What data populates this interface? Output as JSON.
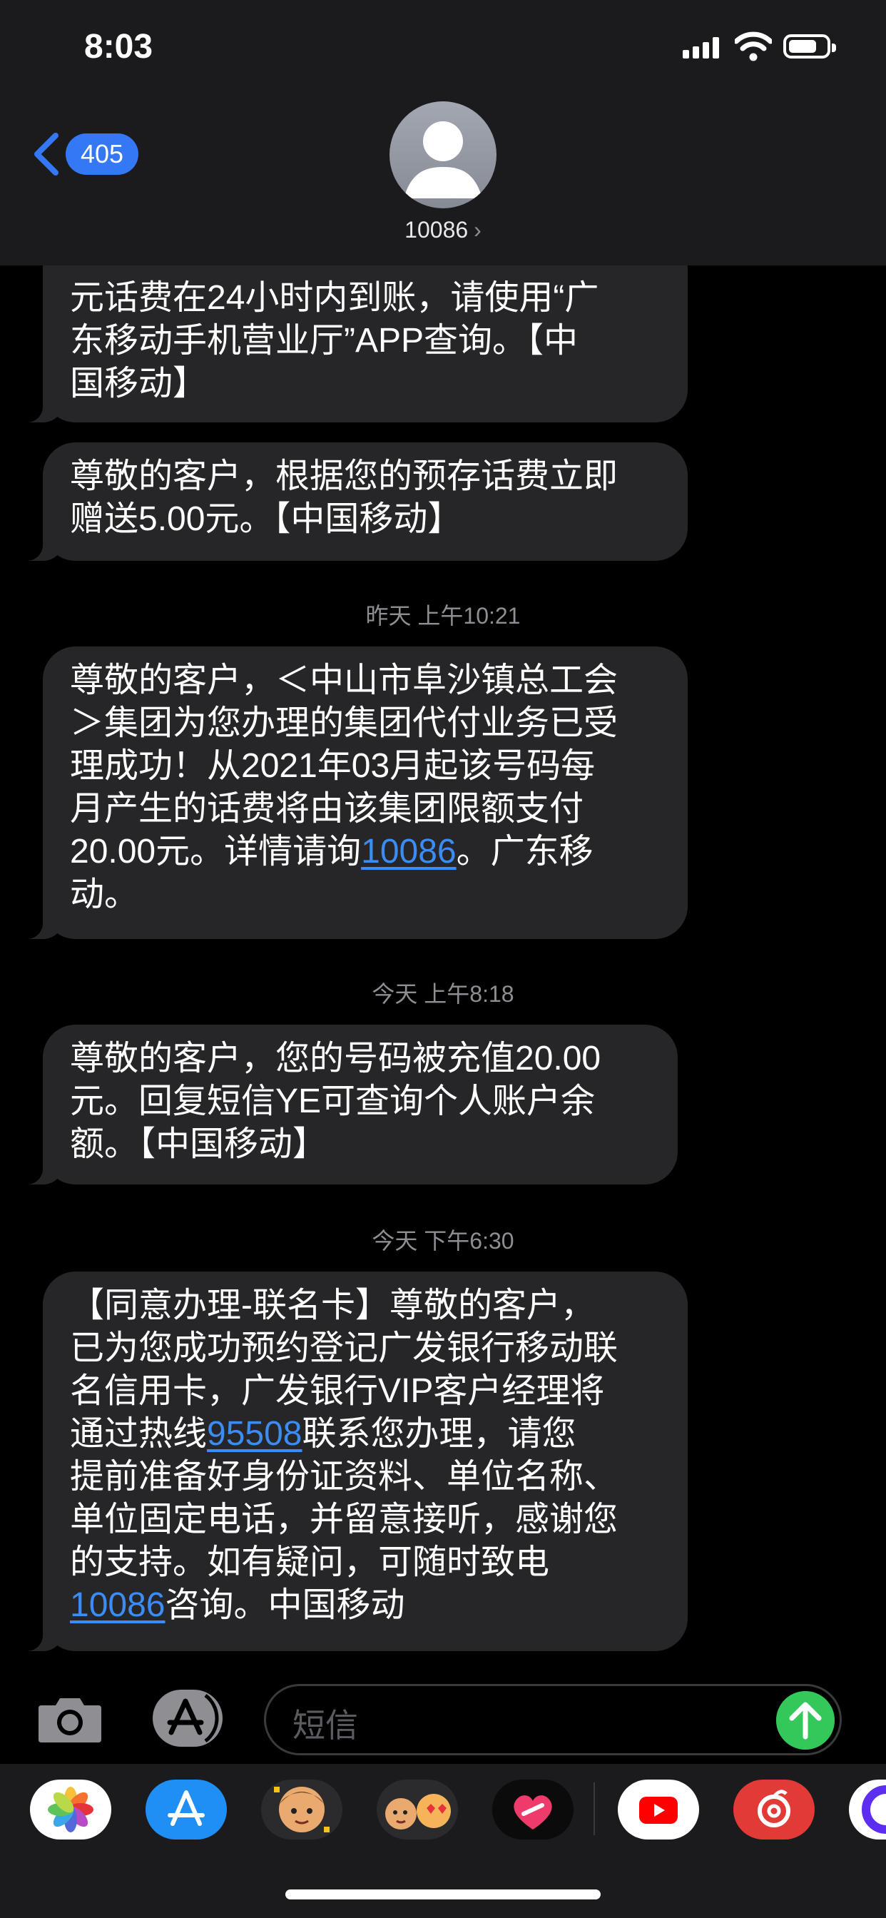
{
  "status_bar": {
    "time": "8:03",
    "battery_level": 0.75
  },
  "header": {
    "back_count": "405",
    "contact": "10086",
    "contact_chevron": "›"
  },
  "messages": [
    {
      "lines": [
        "元话费在24小时内到账，请使用“广",
        "东移动手机营业厅”APP查询。【中",
        "国移动】"
      ]
    },
    {
      "lines": [
        "尊敬的客户，根据您的预存话费立即",
        "赠送5.00元。【中国移动】"
      ]
    },
    {
      "timestamp": "昨天 上午10:21",
      "lines": [
        "尊敬的客户，＜中山市阜沙镇总工会",
        "＞集团为您办理的集团代付业务已受",
        "理成功！从2021年03月起该号码每",
        "月产生的话费将由该集团限额支付"
      ],
      "line5_pre": "20.00元。详情请询",
      "line5_link": "10086",
      "line5_post": "。广东移",
      "line6": "动。"
    },
    {
      "timestamp": "今天 上午8:18",
      "lines": [
        "尊敬的客户，您的号码被充值20.00",
        "元。回复短信YE可查询个人账户余",
        "额。【中国移动】"
      ]
    },
    {
      "timestamp": "今天 下午6:30",
      "lines": [
        "【同意办理-联名卡】尊敬的客户，",
        "已为您成功预约登记广发银行移动联",
        "名信用卡，广发银行VIP客户经理将"
      ],
      "line4_pre": "通过热线",
      "line4_link": "95508",
      "line4_post": "联系您办理，请您",
      "lines_b": [
        "提前准备好身份证资料、单位名称、",
        "单位固定电话，并留意接听，感谢您",
        "的支持。如有疑问，可随时致电"
      ],
      "line8_link": "10086",
      "line8_post": "咨询。中国移动"
    }
  ],
  "input": {
    "placeholder": "短信"
  },
  "app_drawer": [
    "photos-icon",
    "app-store-icon",
    "memoji-icon",
    "animoji-icon",
    "digital-touch-icon",
    "youtube-icon",
    "netease-music-icon",
    "partial-app-icon"
  ],
  "colors": {
    "bubble": "#262628",
    "link": "#3b8cf3",
    "send": "#34c759",
    "badge": "#3478f6"
  }
}
